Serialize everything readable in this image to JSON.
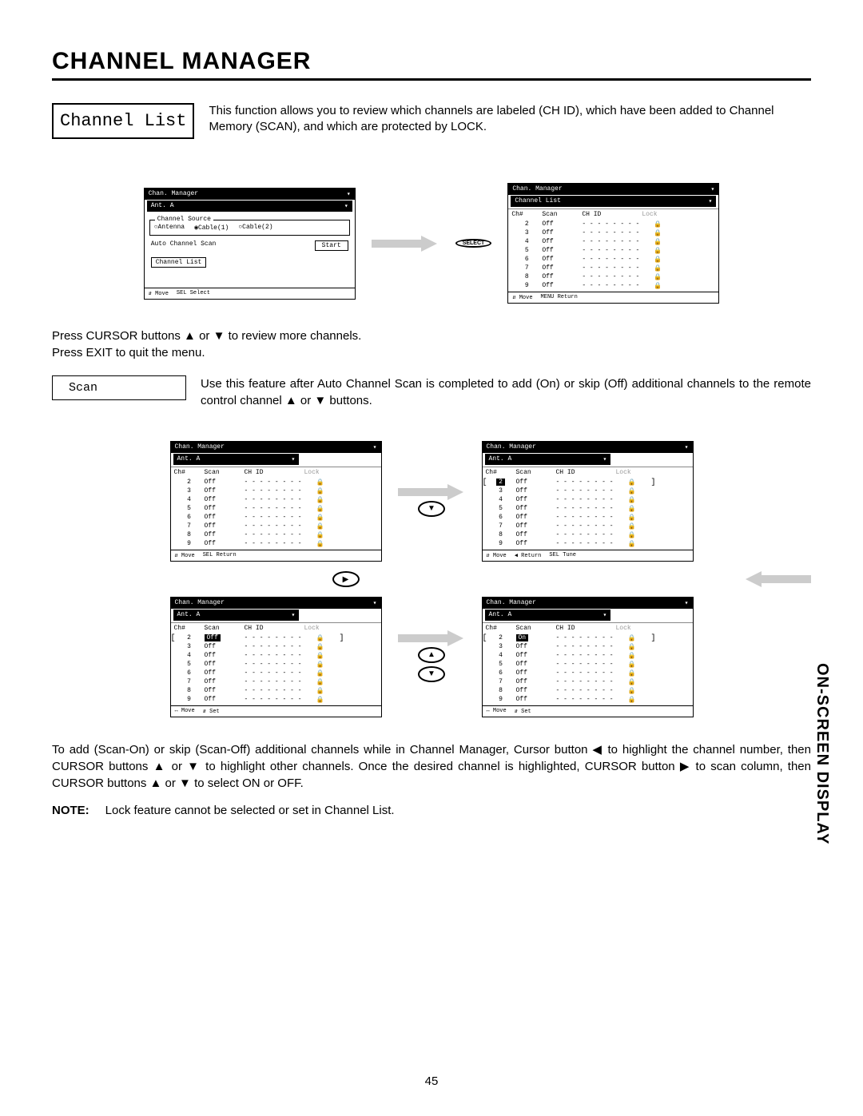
{
  "title": "CHANNEL MANAGER",
  "section_label": "Channel List",
  "intro": "This function allows you to review which channels are labeled (CH ID), which have been added to Channel Memory (SCAN), and which are protected by LOCK.",
  "select_btn": "SELECT",
  "mid_text_1": "Press CURSOR buttons ▲ or ▼ to review more channels.",
  "mid_text_2": "Press EXIT to quit the menu.",
  "scan_label": "Scan",
  "scan_text": "Use this feature after Auto Channel Scan is completed to add (On) or skip (Off) additional channels to the remote control channel ▲ or ▼ buttons.",
  "bottom_text": "To add (Scan-On) or skip (Scan-Off) additional channels while in Channel Manager, Cursor button ◀ to highlight the channel number, then CURSOR buttons ▲ or ▼ to highlight other channels.  Once the desired channel is highlighted, CURSOR button ▶ to scan column, then CURSOR buttons ▲ or ▼ to select ON or OFF.",
  "note_label": "NOTE:",
  "note_text": "Lock feature cannot be selected or set in Channel List.",
  "side_tab": "ON-SCREEN DISPLAY",
  "page_num": "45",
  "osd_common": {
    "header": "Chan. Manager",
    "ant": "Ant. A",
    "list": "Channel List",
    "source_legend": "Channel Source",
    "antenna": "Antenna",
    "cable1": "Cable(1)",
    "cable2": "Cable(2)",
    "auto_scan": "Auto Channel Scan",
    "start": "Start",
    "ch": "Ch#",
    "scan": "Scan",
    "chid": "CH ID",
    "lock": "Lock",
    "move": "Move",
    "select": "Select",
    "return": "Return",
    "tune": "Tune",
    "set": "Set"
  },
  "channel_rows": [
    {
      "ch": "2",
      "scan": "Off",
      "chid": "- - - - - - - -"
    },
    {
      "ch": "3",
      "scan": "Off",
      "chid": "- - - - - - - -"
    },
    {
      "ch": "4",
      "scan": "Off",
      "chid": "- - - - - - - -"
    },
    {
      "ch": "5",
      "scan": "Off",
      "chid": "- - - - - - - -"
    },
    {
      "ch": "6",
      "scan": "Off",
      "chid": "- - - - - - - -"
    },
    {
      "ch": "7",
      "scan": "Off",
      "chid": "- - - - - - - -"
    },
    {
      "ch": "8",
      "scan": "Off",
      "chid": "- - - - - - - -"
    },
    {
      "ch": "9",
      "scan": "Off",
      "chid": "- - - - - - - -"
    }
  ],
  "glyphs": {
    "tri_down": "▾",
    "tri_right": "▸",
    "lock": "🔒",
    "up": "▲",
    "down": "▼",
    "left": "◀",
    "right": "▶",
    "updown": "⇵",
    "lr": "↔"
  }
}
